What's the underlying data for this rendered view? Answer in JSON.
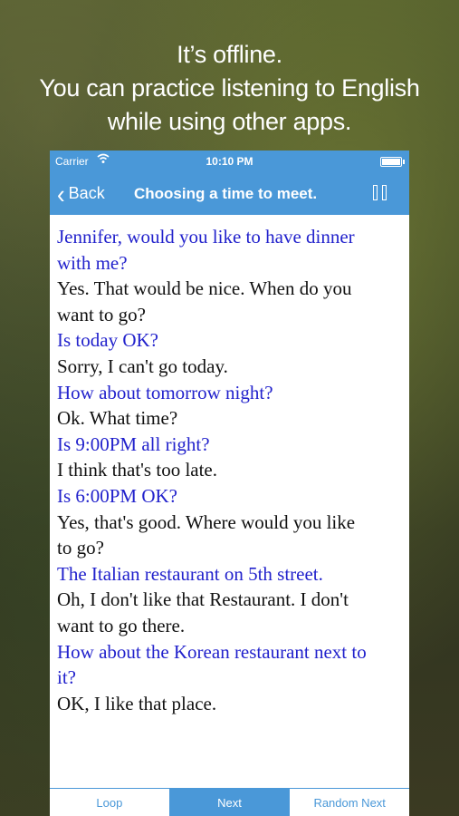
{
  "promo": {
    "line1": "It’s offline.",
    "line2": "You can practice listening to English",
    "line3": "while using other apps."
  },
  "status": {
    "carrier": "Carrier",
    "time": "10:10 PM"
  },
  "navbar": {
    "back_label": "Back",
    "title": "Choosing a time to meet."
  },
  "dialogue": [
    {
      "speaker": "q",
      "text": "Jennifer, would you like to have dinner"
    },
    {
      "speaker": "q",
      "text": "with me?"
    },
    {
      "speaker": "a",
      "text": "Yes. That would be nice. When do you"
    },
    {
      "speaker": "a",
      "text": "want to go?"
    },
    {
      "speaker": "q",
      "text": "Is today OK?"
    },
    {
      "speaker": "a",
      "text": "Sorry, I can't go today."
    },
    {
      "speaker": "q",
      "text": "How about tomorrow night?"
    },
    {
      "speaker": "a",
      "text": "Ok. What time?"
    },
    {
      "speaker": "q",
      "text": "Is 9:00PM all right?"
    },
    {
      "speaker": "a",
      "text": "I think that's too late."
    },
    {
      "speaker": "q",
      "text": "Is 6:00PM OK?"
    },
    {
      "speaker": "a",
      "text": "Yes, that's good. Where would you like"
    },
    {
      "speaker": "a",
      "text": "to go?"
    },
    {
      "speaker": "q",
      "text": "The Italian restaurant on 5th street."
    },
    {
      "speaker": "a",
      "text": "Oh, I don't like that Restaurant. I don't"
    },
    {
      "speaker": "a",
      "text": "want to go there."
    },
    {
      "speaker": "q",
      "text": "How about the Korean restaurant next to"
    },
    {
      "speaker": "q",
      "text": "it?"
    },
    {
      "speaker": "a",
      "text": "OK, I like that place."
    }
  ],
  "tabs": {
    "loop": "Loop",
    "next": "Next",
    "random_next": "Random Next"
  },
  "colors": {
    "accent": "#4a98d8",
    "question_text": "#2222cc",
    "answer_text": "#111111"
  },
  "icons": {
    "wifi": "wifi-icon",
    "battery": "battery-icon",
    "back": "chevron-left-icon",
    "pause": "pause-icon"
  }
}
